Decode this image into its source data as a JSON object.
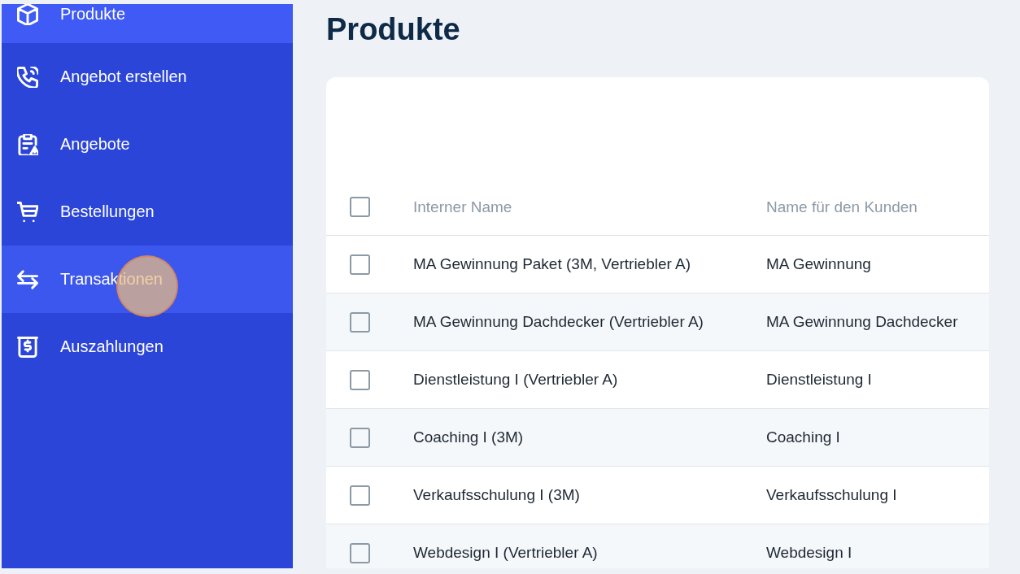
{
  "sidebar": {
    "items": [
      {
        "label": "Produkte",
        "selected": true,
        "hovered": false,
        "clicked": false
      },
      {
        "label": "Angebot erstellen",
        "selected": false,
        "hovered": false,
        "clicked": false
      },
      {
        "label": "Angebote",
        "selected": false,
        "hovered": false,
        "clicked": false
      },
      {
        "label": "Bestellungen",
        "selected": false,
        "hovered": false,
        "clicked": false
      },
      {
        "label": "Transaktionen",
        "selected": false,
        "hovered": true,
        "clicked": true
      },
      {
        "label": "Auszahlungen",
        "selected": false,
        "hovered": false,
        "clicked": false
      }
    ]
  },
  "page": {
    "title": "Produkte"
  },
  "table": {
    "header_checkbox": {
      "checked": false
    },
    "columns": [
      "Interner Name",
      "Name für den Kunden"
    ],
    "rows": [
      {
        "checked": false,
        "cells": [
          "MA Gewinnung Paket (3M, Vertriebler A)",
          "MA Gewinnung"
        ]
      },
      {
        "checked": false,
        "cells": [
          "MA Gewinnung Dachdecker (Vertriebler A)",
          "MA Gewinnung Dachdecker"
        ]
      },
      {
        "checked": false,
        "cells": [
          "Dienstleistung I (Vertriebler A)",
          "Dienstleistung I"
        ]
      },
      {
        "checked": false,
        "cells": [
          "Coaching I (3M)",
          "Coaching I"
        ]
      },
      {
        "checked": false,
        "cells": [
          "Verkaufsschulung I (3M)",
          "Verkaufsschulung I"
        ]
      },
      {
        "checked": false,
        "cells": [
          "Webdesign I (Vertriebler A)",
          "Webdesign I"
        ]
      }
    ]
  }
}
